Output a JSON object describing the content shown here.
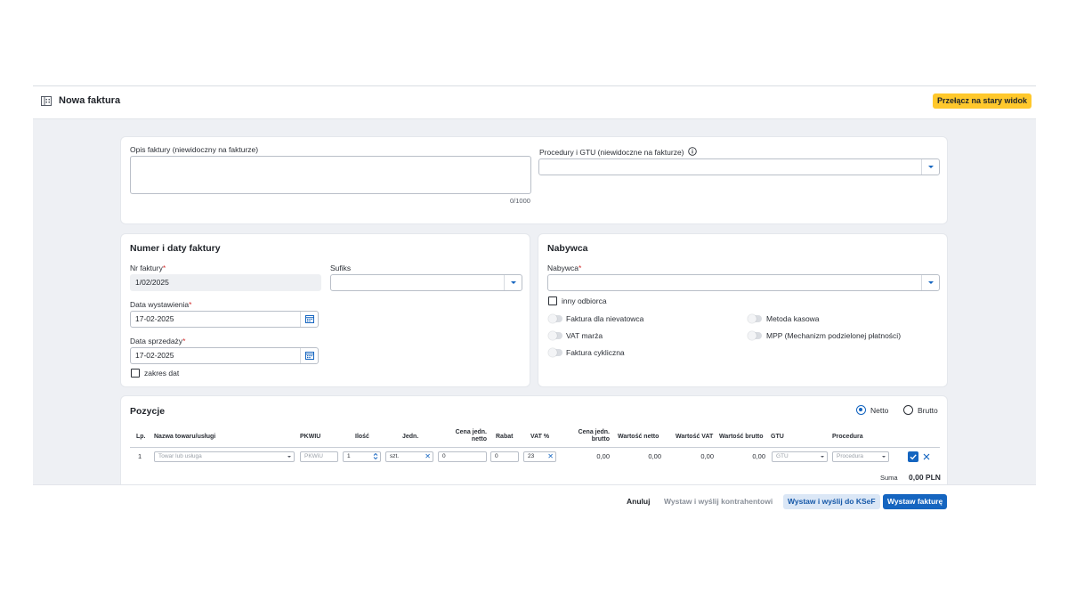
{
  "header": {
    "title": "Nowa faktura",
    "switch_button": "Przełącz na stary widok",
    "icon": "building-icon"
  },
  "description": {
    "label": "Opis faktury (niewidoczny na fakturze)",
    "value": "",
    "counter": "0/1000"
  },
  "procedures": {
    "label": "Procedury i GTU (niewidoczne na fakturze)",
    "value": "",
    "info_icon": "info-circle-icon"
  },
  "numbering": {
    "heading": "Numer i daty faktury",
    "invoice_number_label": "Nr faktury",
    "invoice_number_value": "1/02/2025",
    "suffix_label": "Sufiks",
    "suffix_value": "",
    "issue_date_label": "Data wystawienia",
    "issue_date_value": "17-02-2025",
    "sale_date_label": "Data sprzedaży",
    "sale_date_value": "17-02-2025",
    "date_range_label": "zakres dat",
    "required_mark": "*"
  },
  "buyer": {
    "heading": "Nabywca",
    "buyer_label": "Nabywca",
    "buyer_value": "",
    "other_recipient_label": "inny odbiorca",
    "toggles": {
      "non_vat_invoice": "Faktura dla nievatowca",
      "cash_method": "Metoda kasowa",
      "vat_margin": "VAT marża",
      "mpp": "MPP (Mechanizm podzielonej płatności)",
      "cyclic_invoice": "Faktura cykliczna"
    }
  },
  "items": {
    "heading": "Pozycje",
    "netto_label": "Netto",
    "brutto_label": "Brutto",
    "selected_mode": "Netto",
    "columns": {
      "lp": "Lp.",
      "name": "Nazwa towaru/usługi",
      "pkwiu": "PKWIU",
      "qty": "Ilość",
      "unit": "Jedn.",
      "unit_net_price": "Cena jedn. netto",
      "discount": "Rabat",
      "vat": "VAT %",
      "unit_gross_price": "Cena jedn. brutto",
      "net_value": "Wartość netto",
      "vat_value": "Wartość VAT",
      "gross_value": "Wartość brutto",
      "gtu": "GTU",
      "procedure": "Procedura"
    },
    "rows": [
      {
        "lp": "1",
        "name_placeholder": "Towar lub usługa",
        "pkwiu_placeholder": "PKWiU",
        "qty": "1",
        "unit": "szt.",
        "unit_net_price": "0",
        "discount": "0",
        "vat": "23",
        "unit_gross_price": "0,00",
        "net_value": "0,00",
        "vat_value": "0,00",
        "gross_value": "0,00",
        "gtu_placeholder": "GTU",
        "procedure_placeholder": "Procedura"
      }
    ],
    "sum_label": "Suma",
    "sum_value": "0,00 PLN"
  },
  "footer": {
    "cancel": "Anuluj",
    "issue_send_contractor": "Wystaw i wyślij kontrahentowi",
    "issue_send_ksef": "Wystaw i wyślij do KSeF",
    "issue": "Wystaw fakturę"
  },
  "colors": {
    "accent": "#1565c0",
    "switch_button_bg": "#ffc82c",
    "required": "#d32f2f",
    "app_bg": "#eef0f4"
  }
}
